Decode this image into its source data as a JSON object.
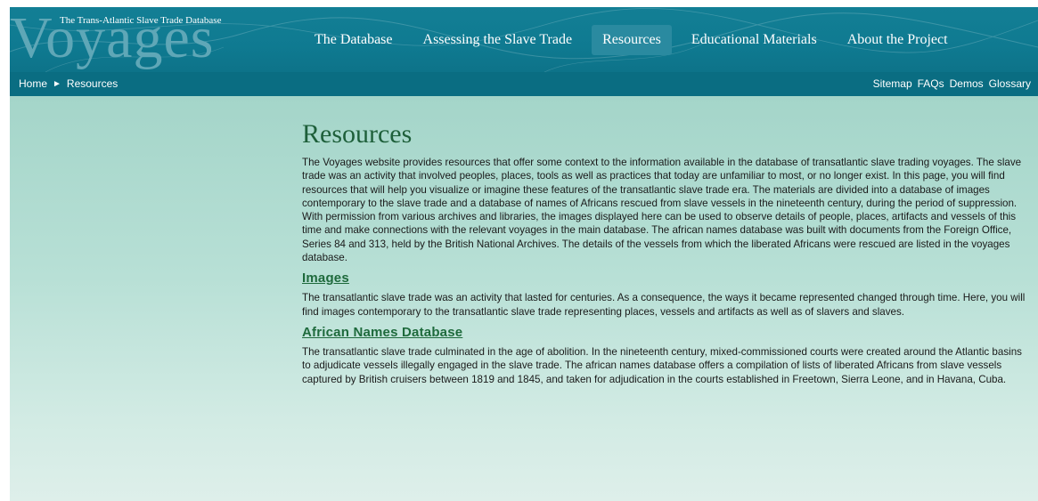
{
  "header": {
    "logo_subtitle": "The Trans-Atlantic Slave Trade Database",
    "logo_word": "Voyages",
    "nav": [
      {
        "label": "The Database",
        "active": false
      },
      {
        "label": "Assessing the Slave Trade",
        "active": false
      },
      {
        "label": "Resources",
        "active": true
      },
      {
        "label": "Educational Materials",
        "active": false
      },
      {
        "label": "About the Project",
        "active": false
      }
    ]
  },
  "breadcrumb": {
    "home": "Home",
    "separator": "►",
    "current": "Resources"
  },
  "util_links": [
    "Sitemap",
    "FAQs",
    "Demos",
    "Glossary"
  ],
  "main": {
    "title": "Resources",
    "intro": "The Voyages website provides resources that offer some context to the information available in the database of transatlantic slave trading voyages. The slave trade was an activity that involved peoples, places, tools as well as practices that today are unfamiliar to most, or no longer exist. In this page, you will find resources that will help you visualize or imagine these features of the transatlantic slave trade era. The materials are divided into a database of images contemporary to the slave trade and a database of names of Africans rescued from slave vessels in the nineteenth century, during the period of suppression. With permission from various archives and libraries, the images displayed here can be used to observe details of people, places, artifacts and vessels of this time and make connections with the relevant voyages in the main database. The african names database was built with documents from the Foreign Office, Series 84 and 313, held by the British National Archives. The details of the vessels from which the liberated Africans were rescued are listed in the voyages database.",
    "sections": [
      {
        "heading": "Images",
        "text": "The transatlantic slave trade was an activity that lasted for centuries. As a consequence, the ways it became represented changed through time. Here, you will find images contemporary to the transatlantic slave trade representing places, vessels and artifacts as well as of slavers and slaves."
      },
      {
        "heading": "African Names Database",
        "text": "The transatlantic slave trade culminated in the age of abolition. In the nineteenth century, mixed-commissioned courts were created around the Atlantic basins to adjudicate vessels illegally engaged in the slave trade. The african names database offers a compilation of lists of liberated Africans from slave vessels captured by British cruisers between 1819 and 1845, and taken for adjudication in the courts established in Freetown, Sierra Leone, and in Havana, Cuba."
      }
    ]
  },
  "colors": {
    "header_bg": "#137f95",
    "subbar_bg": "#0a6d82",
    "active_tab": "#2a8aa0",
    "title_green": "#1e5f3a",
    "link_green": "#1e6a3c",
    "content_bg_top": "#a4d5c9",
    "content_bg_bottom": "#deefea"
  }
}
